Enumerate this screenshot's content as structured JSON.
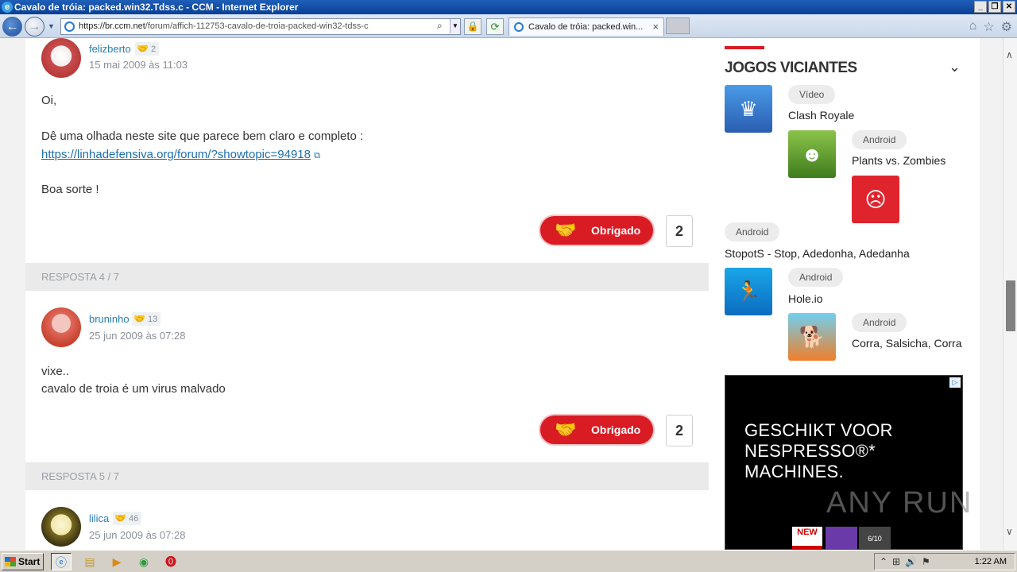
{
  "window": {
    "title": "Cavalo de tróia: packed.win32.Tdss.c - CCM - Internet Explorer"
  },
  "browser": {
    "url_host": "https://br.ccm.net",
    "url_path": "/forum/affich-112753-cavalo-de-troia-packed-win32-tdss-c",
    "tab_title": "Cavalo de tróia: packed.win...",
    "tab_close": "×"
  },
  "posts": [
    {
      "user": "felizberto",
      "rep": "2",
      "date": "15 mai 2009 às 11:03",
      "lines": [
        "Oi,",
        "Dê uma olhada neste site que parece bem claro e completo :"
      ],
      "link": "https://linhadefensiva.org/forum/?showtopic=94918",
      "closing": "Boa sorte !",
      "thanks_label": "Obrigado",
      "thanks_count": "2"
    },
    {
      "reply_label": "RESPOSTA 4 / 7",
      "user": "bruninho",
      "rep": "13",
      "date": "25 jun 2009 às 07:28",
      "lines": [
        "vixe..",
        "cavalo de troia é um virus malvado"
      ],
      "thanks_label": "Obrigado",
      "thanks_count": "2"
    },
    {
      "reply_label": "RESPOSTA 5 / 7",
      "user": "lilica",
      "rep": "46",
      "date": "25 jun 2009 às 07:28"
    }
  ],
  "sidebar": {
    "title": "JOGOS VICIANTES",
    "games": [
      {
        "tag": "Vídeo",
        "name": "Clash Royale"
      },
      {
        "tag": "Android",
        "name": "Plants vs. Zombies"
      },
      {
        "tag": "Android",
        "name": "StopotS - Stop, Adedonha, Adedanha"
      },
      {
        "tag": "Android",
        "name": "Hole.io"
      },
      {
        "tag": "Android",
        "name": "Corra, Salsicha, Corra"
      }
    ],
    "ad": {
      "line1": "GESCHIKT VOOR",
      "line2": "NESPRESSO®* MACHINES.",
      "badge": "NEW",
      "box": "6/10"
    }
  },
  "watermark": "ANY RUN",
  "taskbar": {
    "start": "Start",
    "clock": "1:22 AM"
  }
}
